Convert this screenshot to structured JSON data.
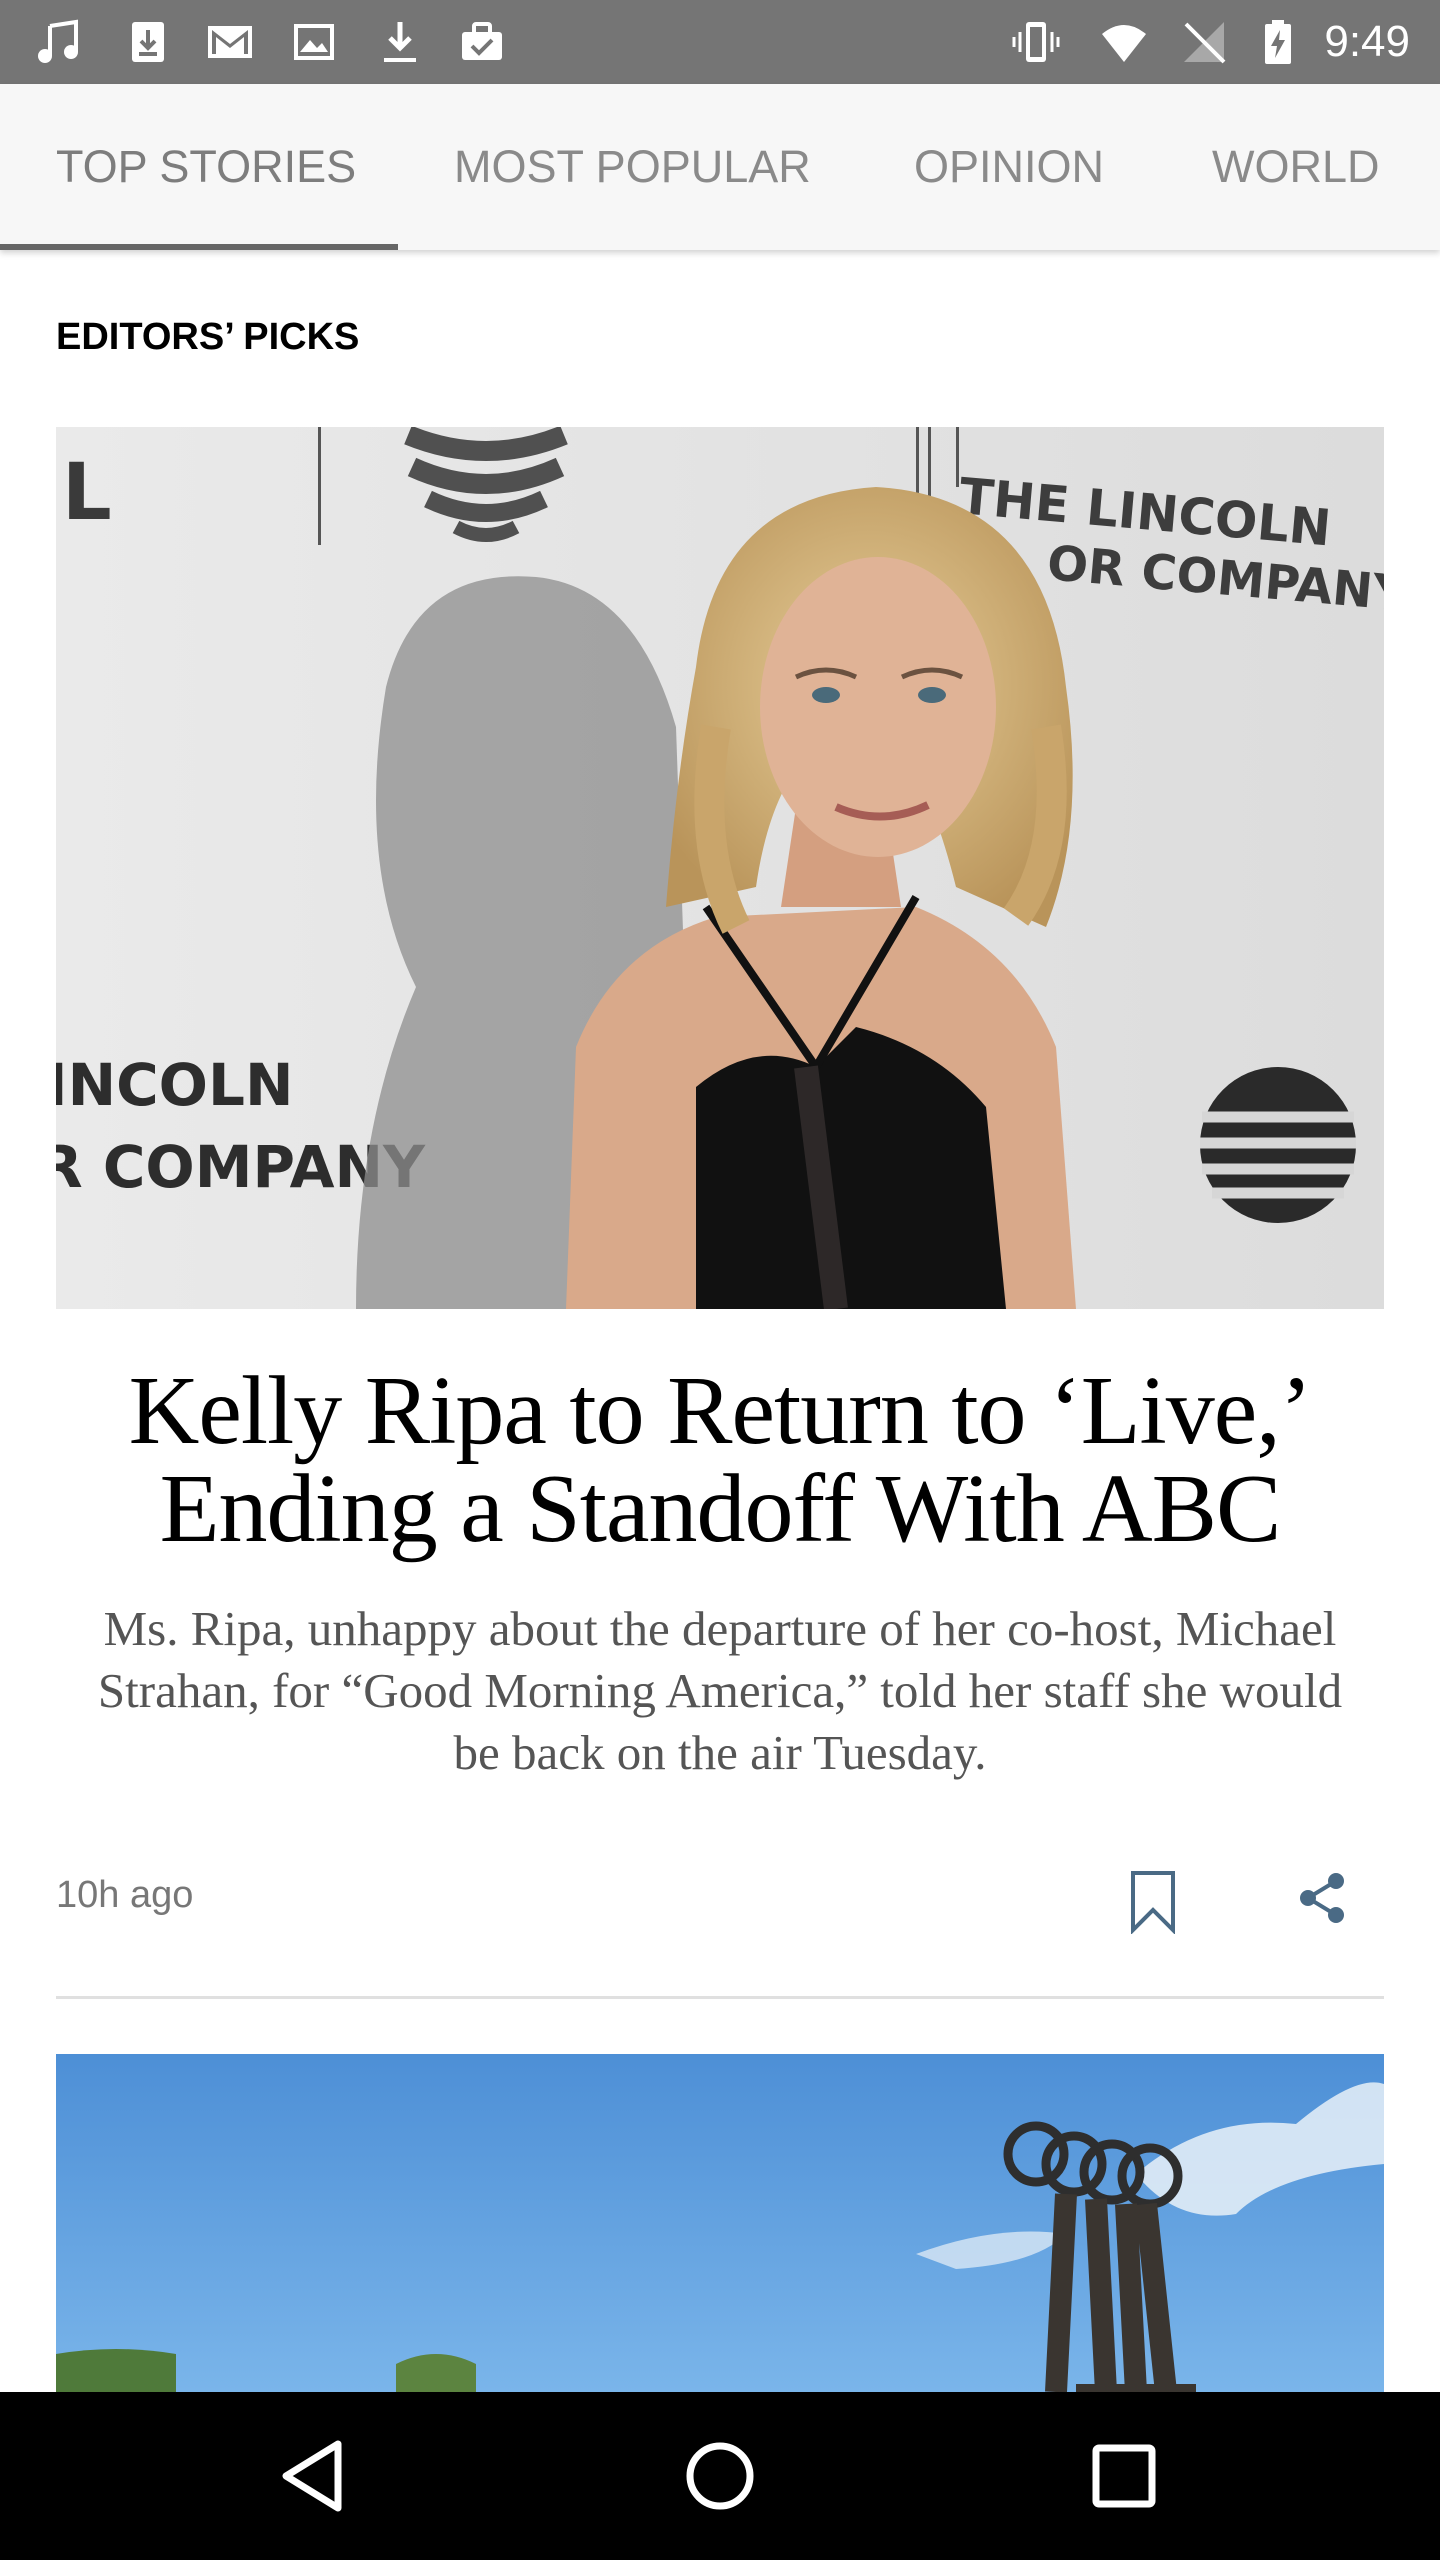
{
  "status_bar": {
    "time": "9:49",
    "left_icons": [
      "music-icon",
      "download-box-icon",
      "gmail-icon",
      "image-icon",
      "download-icon",
      "briefcase-check-icon"
    ],
    "right_icons": [
      "vibrate-icon",
      "wifi-icon",
      "no-signal-icon",
      "battery-charging-icon"
    ]
  },
  "tabs": [
    {
      "label": "TOP STORIES",
      "active": true
    },
    {
      "label": "MOST POPULAR",
      "active": false
    },
    {
      "label": "OPINION",
      "active": false
    },
    {
      "label": "WORLD",
      "active": false
    }
  ],
  "section_label": "EDITORS’ PICKS",
  "article": {
    "headline": "Kelly Ripa to Return to ‘Live,’ Ending a Standoff With ABC",
    "summary": "Ms. Ripa, unhappy about the departure of her co-host, Michael Strahan, for “Good Morning America,” told her staff she would be back on the air Tuesday.",
    "timestamp": "10h ago",
    "image_backdrop_text": [
      "THE LINCOLN",
      "OR COMPANY",
      "INCOLN",
      "R COMPANY",
      "L"
    ]
  },
  "nav_bar": {
    "icons": [
      "back-icon",
      "home-icon",
      "recents-icon"
    ]
  },
  "colors": {
    "status_bar": "#757575",
    "tab_bar": "#f7f7f7",
    "tab_text": "#8a8a8a",
    "tab_indicator": "#666666",
    "summary_text": "#555555",
    "icon_accent": "#4a6a85",
    "nav_bar": "#000000"
  }
}
